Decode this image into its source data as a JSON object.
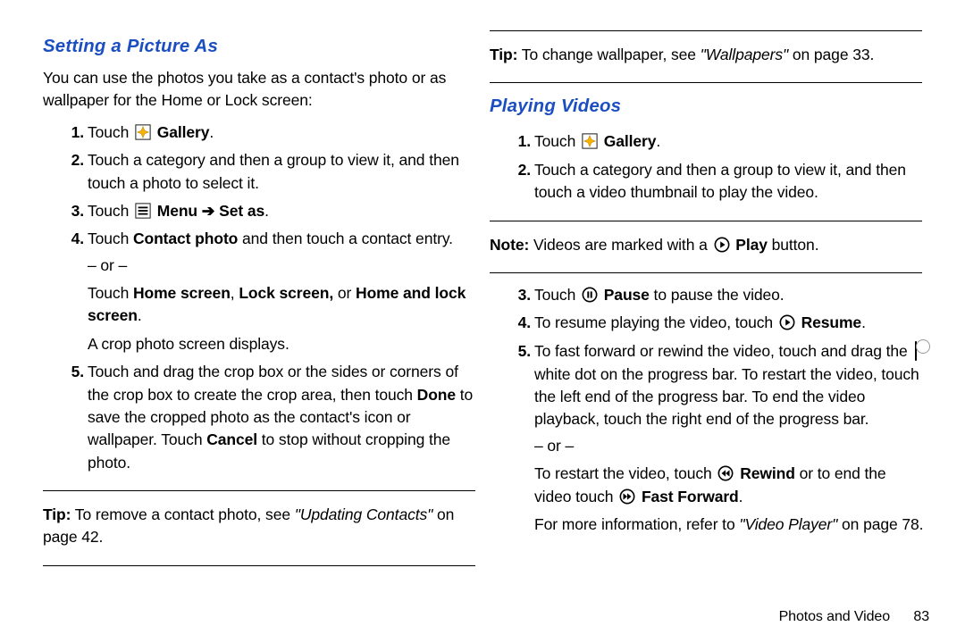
{
  "left": {
    "heading": "Setting a Picture As",
    "intro": "You can use the photos you take as a contact's photo or as wallpaper for the Home or Lock screen:",
    "step1_a": "Touch",
    "step1_b": "Gallery",
    "step1_c": ".",
    "step2": "Touch a category and then a group to view it, and then touch a photo to select it.",
    "step3_a": "Touch",
    "step3_b": "Menu",
    "step3_arrow": "➔",
    "step3_c": "Set as",
    "step3_d": ".",
    "step4_a": "Touch ",
    "step4_b": "Contact photo",
    "step4_c": " and then touch a contact entry.",
    "step4_or": "– or –",
    "step4_d": "Touch ",
    "step4_e": "Home screen",
    "step4_f": ", ",
    "step4_g": "Lock screen,",
    "step4_h": " or ",
    "step4_i": "Home and lock screen",
    "step4_j": ".",
    "step4_crop": "A crop photo screen displays.",
    "step5_a": "Touch and drag the crop box or the sides or corners of the crop box to create the crop area, then touch ",
    "step5_b": "Done",
    "step5_c": " to save the cropped photo as the contact's icon or wallpaper. Touch ",
    "step5_d": "Cancel",
    "step5_e": " to stop without cropping the photo.",
    "tip_a": "Tip:",
    "tip_b": " To remove a contact photo, see ",
    "tip_c": "\"Updating Contacts\"",
    "tip_d": " on page 42."
  },
  "right": {
    "tip1_a": "Tip:",
    "tip1_b": " To change wallpaper, see ",
    "tip1_c": "\"Wallpapers\"",
    "tip1_d": " on page 33.",
    "heading": "Playing Videos",
    "step1_a": "Touch",
    "step1_b": "Gallery",
    "step1_c": ".",
    "step2": "Touch a category and then a group to view it, and then touch a video thumbnail to play the video.",
    "note_a": "Note:",
    "note_b": " Videos are marked with a",
    "note_c": "Play",
    "note_d": " button.",
    "step3_a": "Touch",
    "step3_b": "Pause",
    "step3_c": " to pause the video.",
    "step4_a": "To resume playing the video, touch",
    "step4_b": "Resume",
    "step4_c": ".",
    "step5_a": "To fast forward or rewind the video, touch and drag the",
    "step5_b": "white dot on the progress bar. To restart the video, touch the left end of the progress bar. To end the video playback, touch the right end of the progress bar.",
    "step5_or": "– or –",
    "step5_c": "To restart the video, touch",
    "step5_d": "Rewind",
    "step5_e": " or to end the video touch",
    "step5_f": "Fast Forward",
    "step5_g": ".",
    "moreinfo_a": "For more information, refer to ",
    "moreinfo_b": "\"Video Player\"",
    "moreinfo_c": " on page 78."
  },
  "footer": {
    "chapter": "Photos and Video",
    "page": "83"
  }
}
